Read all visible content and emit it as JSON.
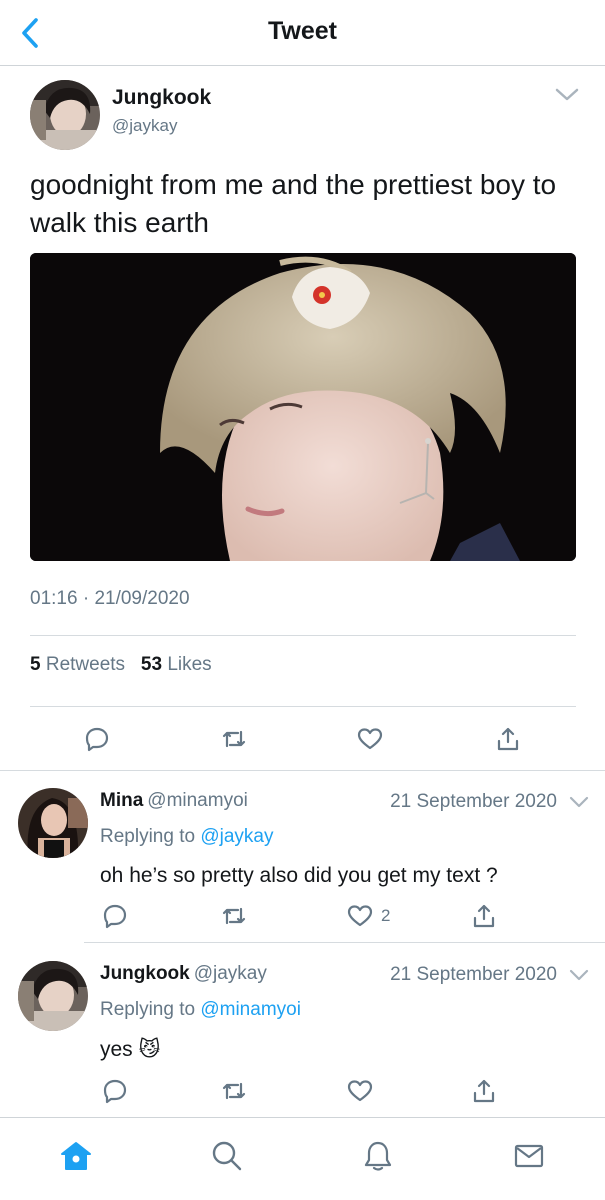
{
  "header": {
    "title": "Tweet",
    "back_icon": "chevron-left-icon",
    "accent": "#1da1f2"
  },
  "tweet": {
    "author_name": "Jungkook",
    "author_handle": "@jaykay",
    "text": "goodnight from me and the prettiest boy to walk this earth",
    "time": "01:16",
    "separator": "·",
    "date": "21/09/2020",
    "retweet_count": "5",
    "retweet_label": "Retweets",
    "like_count": "53",
    "like_label": "Likes",
    "media": "photo"
  },
  "replies": [
    {
      "author_name": "Mina",
      "author_handle": "@minamyoi",
      "date": "21 September 2020",
      "replying_prefix": "Replying to",
      "replying_to": "@jaykay",
      "text": "oh he’s so pretty also did you get my text ?",
      "like_count": "2"
    },
    {
      "author_name": "Jungkook",
      "author_handle": "@jaykay",
      "date": "21 September 2020",
      "replying_prefix": "Replying to",
      "replying_to": "@minamyoi",
      "text": "yes 😼",
      "like_count": ""
    }
  ],
  "tabbar": {
    "items": [
      "home-icon",
      "search-icon",
      "notifications-icon",
      "messages-icon"
    ],
    "active": "home-icon"
  },
  "colors": {
    "text": "#14171a",
    "secondary": "#657786",
    "link": "#1da1f2",
    "divider": "#d6dbdf"
  }
}
